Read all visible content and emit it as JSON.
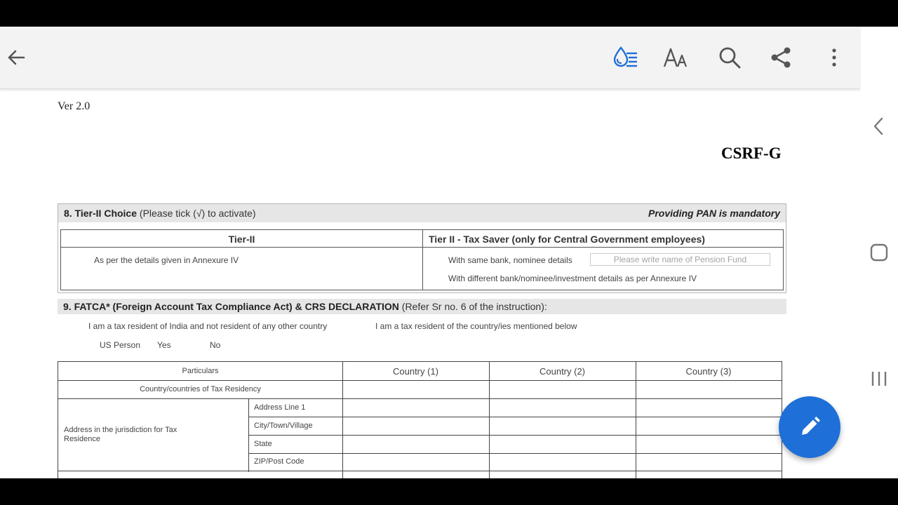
{
  "toolbar": {
    "back_icon": "arrow-left-icon",
    "reading_mode_icon": "reading-mode-icon",
    "text_size_icon": "text-size-icon",
    "search_icon": "search-icon",
    "share_icon": "share-icon",
    "more_icon": "more-vert-icon",
    "accent": "#1e6fd8"
  },
  "side_nav": {
    "back_icon": "chevron-left-icon",
    "home_icon": "square-icon",
    "recents_icon": "recents-icon"
  },
  "document": {
    "version": "Ver 2.0",
    "form_code": "CSRF-G",
    "section8": {
      "number": "8.",
      "title": "Tier-II Choice",
      "note": "(Please tick (√) to activate)",
      "mandatory": "Providing PAN is mandatory",
      "col1_header": "Tier-II",
      "col2_header": "Tier II - Tax Saver (only for Central Government employees)",
      "col1_text": "As per the details given in Annexure IV",
      "col2_option1": "With same bank, nominee details",
      "pension_fund_placeholder": "Please write name of Pension Fund",
      "col2_option2": "With different bank/nominee/investment details as per Annexure IV"
    },
    "section9": {
      "number": "9.",
      "title": "FATCA* (Foreign Account Tax Compliance Act) & CRS DECLARATION",
      "note": "(Refer Sr no. 6 of the instruction):",
      "option1": "I am a tax resident of India and not resident of any other country",
      "option2": "I am a tax resident of the country/ies mentioned below",
      "us_person_label": "US Person",
      "yes_label": "Yes",
      "no_label": "No",
      "table": {
        "particulars_header": "Particulars",
        "country_headers": [
          "Country (1)",
          "Country (2)",
          "Country (3)"
        ],
        "tax_residency_label": "Country/countries of Tax Residency",
        "address_label": "Address in the jurisdiction for Tax Residence",
        "address_lines": [
          "Address Line 1",
          "City/Town/Village",
          "State",
          "ZIP/Post Code"
        ]
      }
    }
  },
  "fab": {
    "icon": "pencil-icon",
    "color": "#1e6fd8"
  }
}
